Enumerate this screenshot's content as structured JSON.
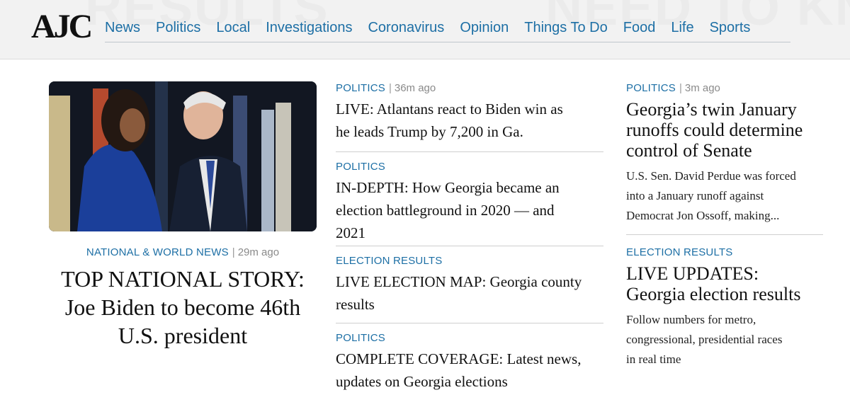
{
  "header": {
    "logo": "AJC",
    "nav": [
      "News",
      "Politics",
      "Local",
      "Investigations",
      "Coronavirus",
      "Opinion",
      "Things To Do",
      "Food",
      "Life",
      "Sports"
    ]
  },
  "lead": {
    "kicker": "NATIONAL & WORLD NEWS",
    "time": "29m ago",
    "headline_lines": [
      "TOP NATIONAL STORY:",
      "Joe Biden to become 46th",
      "U.S. president"
    ]
  },
  "middle": [
    {
      "kicker": "POLITICS",
      "time": "36m ago",
      "lines": [
        "LIVE: Atlantans react to Biden win as",
        "he leads Trump by 7,200 in Ga."
      ]
    },
    {
      "kicker": "POLITICS",
      "time": "",
      "lines": [
        "IN-DEPTH: How Georgia became an",
        "election battleground in 2020 — and",
        "2021"
      ]
    },
    {
      "kicker": "ELECTION RESULTS",
      "time": "",
      "lines": [
        "LIVE ELECTION MAP: Georgia county",
        "results"
      ]
    },
    {
      "kicker": "POLITICS",
      "time": "",
      "lines": [
        "COMPLETE COVERAGE: Latest news,",
        "updates on Georgia elections"
      ]
    }
  ],
  "right": [
    {
      "kicker": "POLITICS",
      "time": "3m ago",
      "lines": [
        "Georgia’s twin January",
        "runoffs could determine",
        "control of Senate"
      ],
      "summary_lines": [
        "U.S. Sen. David Perdue was forced",
        "into a January runoff against",
        "Democrat Jon Ossoff, making..."
      ]
    },
    {
      "kicker": "ELECTION RESULTS",
      "time": "",
      "lines": [
        "LIVE UPDATES:",
        "Georgia election results"
      ],
      "summary_lines": [
        "Follow numbers for metro,",
        "congressional, presidential races",
        "in real time"
      ]
    }
  ]
}
